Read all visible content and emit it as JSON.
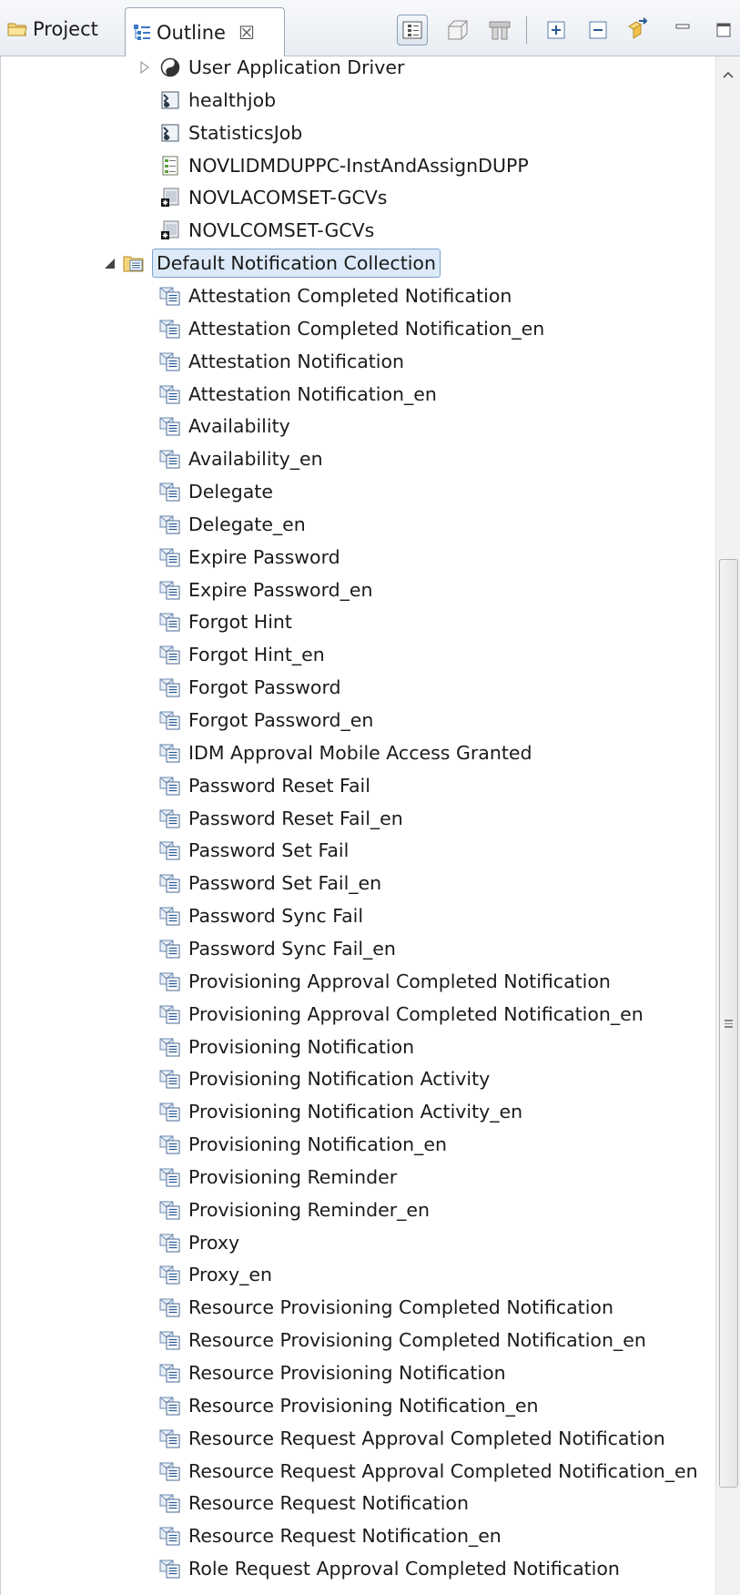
{
  "tabs": {
    "project": {
      "label": "Project",
      "icon": "folder-icon"
    },
    "outline": {
      "label": "Outline",
      "icon": "outline-tree-icon",
      "close_glyph": "☒"
    }
  },
  "toolbar": {
    "icons": [
      "tree-view-icon",
      "open-editor-icon",
      "filter-icon",
      "expand-all-icon",
      "collapse-all-icon",
      "link-editor-icon",
      "minimize-icon",
      "maximize-icon"
    ]
  },
  "tree": {
    "top_items": [
      {
        "label": "User Application Driver",
        "icon": "driver-icon",
        "expandable": true
      },
      {
        "label": "healthjob",
        "icon": "job-icon"
      },
      {
        "label": "StatisticsJob",
        "icon": "job-icon"
      },
      {
        "label": "NOVLIDMDUPPC-InstAndAssignDUPP",
        "icon": "package-icon"
      },
      {
        "label": "NOVLACOMSET-GCVs",
        "icon": "gcv-icon"
      },
      {
        "label": "NOVLCOMSET-GCVs",
        "icon": "gcv-icon"
      }
    ],
    "collection": {
      "label": "Default Notification Collection",
      "icon": "notification-collection-icon",
      "expanded": true
    },
    "notifications": [
      "Attestation Completed Notification",
      "Attestation Completed Notification_en",
      "Attestation Notification",
      "Attestation Notification_en",
      "Availability",
      "Availability_en",
      "Delegate",
      "Delegate_en",
      "Expire Password",
      "Expire Password_en",
      "Forgot Hint",
      "Forgot Hint_en",
      "Forgot Password",
      "Forgot Password_en",
      "IDM Approval Mobile Access Granted",
      "Password Reset Fail",
      "Password Reset Fail_en",
      "Password Set Fail",
      "Password Set Fail_en",
      "Password Sync Fail",
      "Password Sync Fail_en",
      "Provisioning Approval Completed Notification",
      "Provisioning Approval Completed Notification_en",
      "Provisioning Notification",
      "Provisioning Notification Activity",
      "Provisioning Notification Activity_en",
      "Provisioning Notification_en",
      "Provisioning Reminder",
      "Provisioning Reminder_en",
      "Proxy",
      "Proxy_en",
      "Resource Provisioning Completed Notification",
      "Resource Provisioning Completed Notification_en",
      "Resource Provisioning Notification",
      "Resource Provisioning Notification_en",
      "Resource Request Approval Completed Notification",
      "Resource Request Approval Completed Notification_en",
      "Resource Request Notification",
      "Resource Request Notification_en",
      "Role Request Approval Completed Notification"
    ]
  },
  "colors": {
    "selection_bg": "#dce9f8",
    "selection_border": "#7da2ce",
    "tab_border": "#9aa7b8"
  }
}
